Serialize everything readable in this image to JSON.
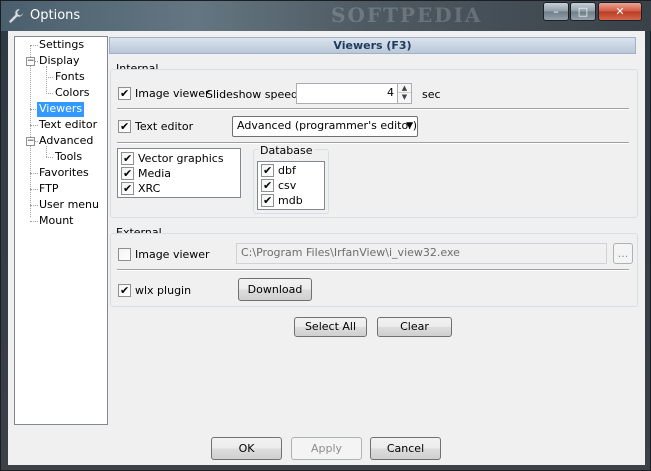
{
  "window": {
    "title": "Options",
    "watermark": "SOFTPEDIA",
    "caption_buttons": {
      "minimize": "–",
      "maximize": "□",
      "close": "✕"
    }
  },
  "tree": {
    "items": [
      {
        "label": "Settings"
      },
      {
        "label": "Display"
      },
      {
        "label": "Fonts"
      },
      {
        "label": "Colors"
      },
      {
        "label": "Viewers"
      },
      {
        "label": "Text editor"
      },
      {
        "label": "Advanced"
      },
      {
        "label": "Tools"
      },
      {
        "label": "Favorites"
      },
      {
        "label": "FTP"
      },
      {
        "label": "User menu"
      },
      {
        "label": "Mount"
      }
    ],
    "selected": "Viewers"
  },
  "panel": {
    "header": "Viewers (F3)",
    "internal": {
      "label": "Internal",
      "image_viewer": {
        "label": "Image viewer",
        "checked": true
      },
      "slideshow_label": "Slideshow speed:",
      "slideshow_value": "4",
      "slideshow_unit": "sec",
      "text_editor": {
        "label": "Text editor",
        "checked": true
      },
      "text_editor_mode": "Advanced (programmer's editor)",
      "formats": [
        {
          "label": "Vector graphics",
          "checked": true
        },
        {
          "label": "Media",
          "checked": true
        },
        {
          "label": "XRC",
          "checked": true
        }
      ],
      "database_label": "Database",
      "database": [
        {
          "label": "dbf",
          "checked": true
        },
        {
          "label": "csv",
          "checked": true
        },
        {
          "label": "mdb",
          "checked": true
        }
      ]
    },
    "external": {
      "label": "External",
      "image_viewer": {
        "label": "Image viewer",
        "checked": false
      },
      "path": "C:\\Program Files\\IrfanView\\i_view32.exe",
      "browse_label": "...",
      "wlx_plugin": {
        "label": "wlx plugin",
        "checked": true
      },
      "download_label": "Download"
    },
    "select_all_label": "Select All",
    "clear_label": "Clear"
  },
  "footer": {
    "ok_label": "OK",
    "apply_label": "Apply",
    "cancel_label": "Cancel"
  }
}
